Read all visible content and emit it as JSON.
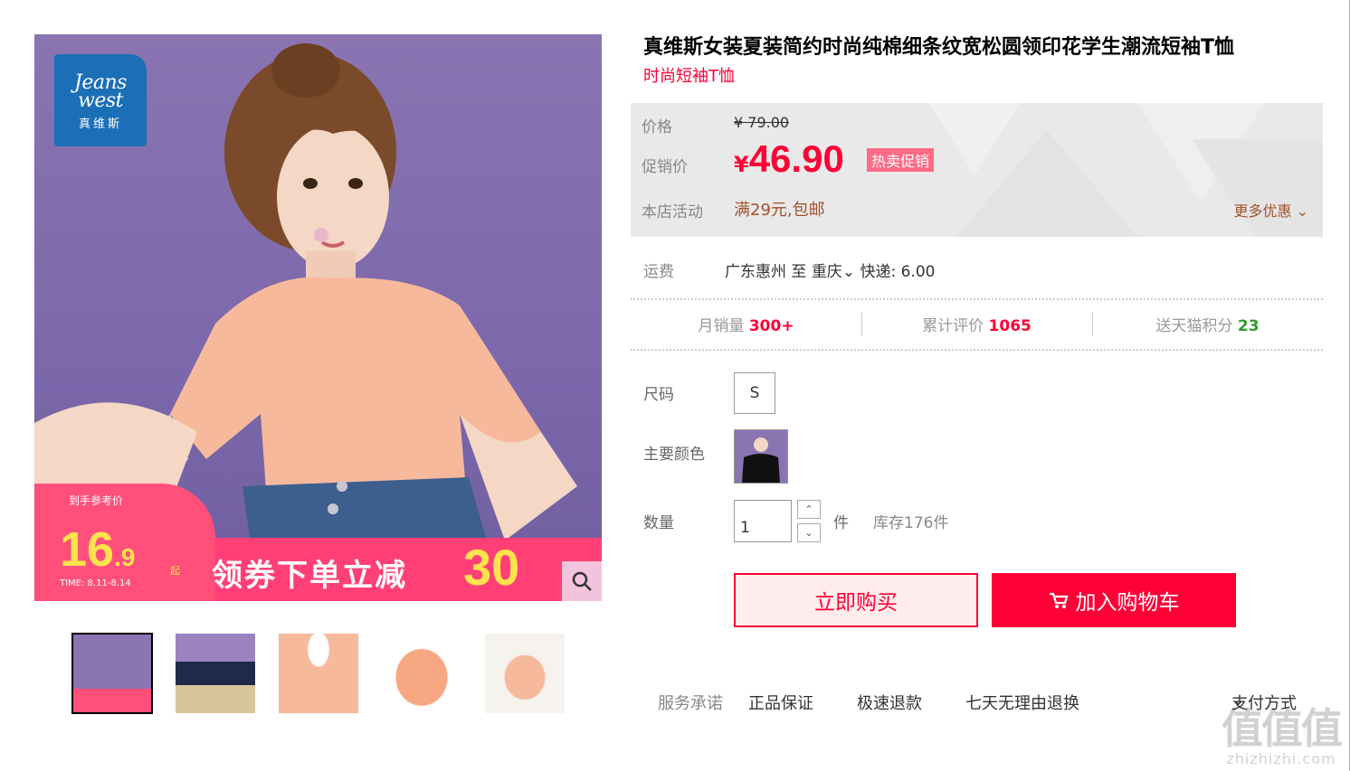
{
  "brand": {
    "line1": "Jeans",
    "line2": "west",
    "line3": "真维斯",
    "color": "#1b6fb7"
  },
  "promo": {
    "ref_label": "到手参考价",
    "price_int": "16",
    "price_dec": ".9",
    "qi": "起",
    "time": "TIME: 8.11-8.14",
    "text": "领券下单立减",
    "amount": "30"
  },
  "gallery": {
    "thumbs": [
      {
        "name": "thumb-model-peach",
        "active": true
      },
      {
        "name": "thumb-model-navy",
        "active": false
      },
      {
        "name": "thumb-collar-detail",
        "active": false
      },
      {
        "name": "thumb-sleeve-detail",
        "active": false
      },
      {
        "name": "thumb-flat-tee",
        "active": false
      }
    ]
  },
  "product": {
    "title": "真维斯女装夏装简约时尚纯棉细条纹宽松圆领印花学生潮流短袖T恤",
    "subtitle": "时尚短袖T恤"
  },
  "price": {
    "label": "价格",
    "original": "¥ 79.00",
    "promo_label": "促销价",
    "currency": "¥",
    "sale": "46.90",
    "hot_tag": "热卖促销",
    "activity_label": "本店活动",
    "activity": "满29元,包邮",
    "more_deals": "更多优惠"
  },
  "shipping": {
    "label": "运费",
    "origin": "广东惠州",
    "to": "至",
    "dest": "重庆",
    "express": "快递: 6.00"
  },
  "stats": {
    "monthly_label": "月销量",
    "monthly_value": "300+",
    "reviews_label": "累计评价",
    "reviews_value": "1065",
    "points_label": "送天猫积分",
    "points_value": "23"
  },
  "options": {
    "size_label": "尺码",
    "size_value": "S",
    "color_label": "主要颜色",
    "qty_label": "数量",
    "qty_value": "1",
    "qty_unit": "件",
    "stock": "库存176件"
  },
  "actions": {
    "buy_now": "立即购买",
    "add_cart": "加入购物车"
  },
  "service": {
    "label": "服务承诺",
    "items": [
      "正品保证",
      "极速退款",
      "七天无理由退换"
    ],
    "payment": "支付方式"
  },
  "watermark": {
    "big": "值值值",
    "small": "zhizhizhi.com"
  },
  "colors": {
    "accent": "#ff0036",
    "price_bg": "#e9e9e9",
    "activity": "#a0522d",
    "points": "#2e9a2e"
  }
}
